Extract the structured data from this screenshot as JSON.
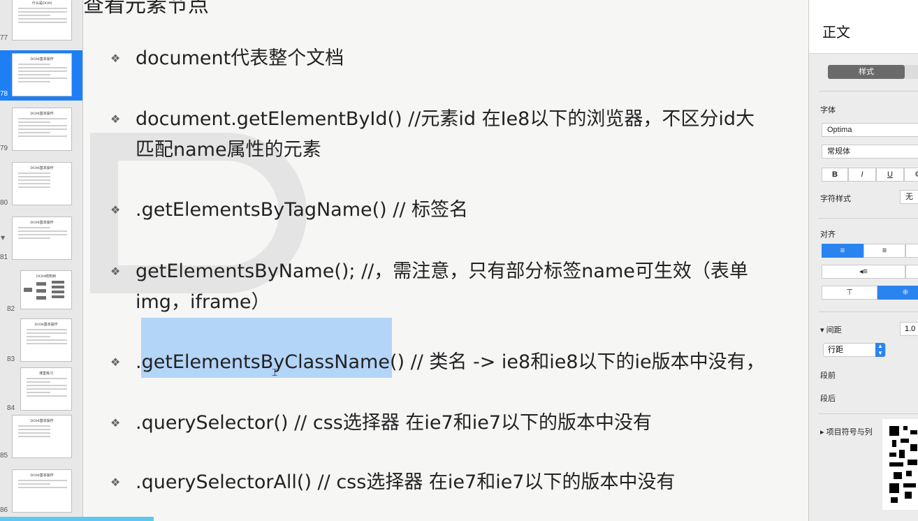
{
  "sidebar": {
    "thumbnails": [
      {
        "num": "77",
        "title": "什么是DOM",
        "selected": false
      },
      {
        "num": "78",
        "title": "DOM基本操作",
        "selected": true
      },
      {
        "num": "79",
        "title": "DOM基本操作",
        "selected": false
      },
      {
        "num": "80",
        "title": "DOM基本操作",
        "selected": false
      },
      {
        "num": "81",
        "title": "DOM基本操作",
        "selected": false
      },
      {
        "num": "82",
        "title": "DOM结构树",
        "selected": false
      },
      {
        "num": "83",
        "title": "DOM基本操作",
        "selected": false
      },
      {
        "num": "84",
        "title": "课堂练习",
        "selected": false
      },
      {
        "num": "85",
        "title": "DOM基本操作",
        "selected": false
      },
      {
        "num": "86",
        "title": "DOM基本操作",
        "selected": false
      }
    ]
  },
  "slide": {
    "title": "查看元素节点",
    "bullets": [
      {
        "line1": "document代表整个文档",
        "line2": ""
      },
      {
        "line1": "document.getElementById() //元素id 在Ie8以下的浏览器，不区分id大",
        "line2": "匹配name属性的元素"
      },
      {
        "line1": ".getElementsByTagName() // 标签名",
        "line2": ""
      },
      {
        "line1": "getElementsByName(); //，需注意，只有部分标签name可生效（表单",
        "line2": "img，iframe）"
      },
      {
        "line1": ".getElementsByClassName() // 类名 -> ie8和ie8以下的ie版本中没有，",
        "line2": ""
      },
      {
        "line1": ".querySelector() // css选择器   在ie7和ie7以下的版本中没有",
        "line2": ""
      },
      {
        "line1": ".querySelectorAll() // css选择器 在ie7和ie7以下的版本中没有",
        "line2": ""
      }
    ],
    "bullet_mark": "❖"
  },
  "inspector": {
    "title": "正文",
    "tab_style": "样式",
    "font_label": "字体",
    "font_family": "Optima",
    "font_style": "常规体",
    "bold": "B",
    "italic": "I",
    "underline": "U",
    "gear": "⚙",
    "char_style_label": "字符样式",
    "char_style_value": "无",
    "align_label": "对齐",
    "spacing_label": "间距",
    "spacing_value": "1.0",
    "line_spacing": "行距",
    "before_para": "段前",
    "after_para": "段后",
    "bullets_label": "项目符号与列"
  }
}
